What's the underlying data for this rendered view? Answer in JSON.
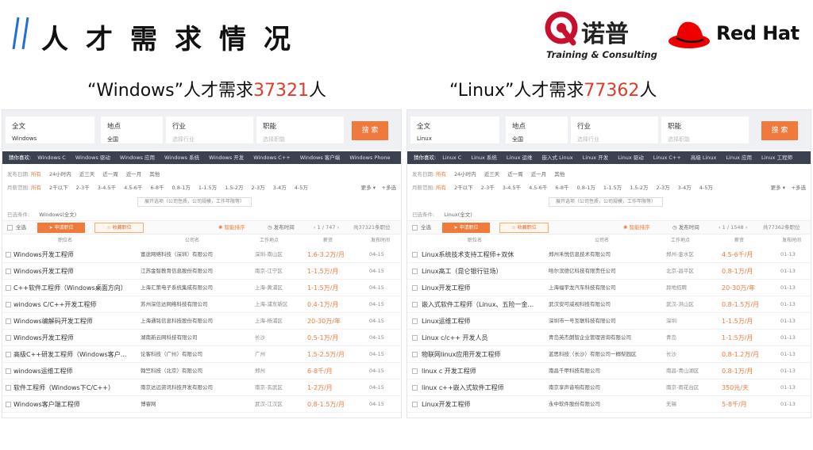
{
  "header": {
    "title": "人才需求情况",
    "nuopu_cn": "诺普",
    "nuopu_en": "Training & Consulting",
    "redhat": "Red Hat"
  },
  "colors": {
    "accent": "#f07a3c",
    "highlight": "#e03b2a",
    "redhat": "#ee0000",
    "nuopu": "#c8102e",
    "slash": "#1e6fd9"
  },
  "left": {
    "caption_pre": "“Windows”人才需求",
    "caption_num": "37321",
    "caption_post": "人",
    "search": {
      "full_label": "全文",
      "full_value": "Windows",
      "loc_label": "地点",
      "loc_value": "全国",
      "ind_label": "行业",
      "ind_ph": "选择行业",
      "pos_label": "职能",
      "pos_ph": "选择职能",
      "button": "搜 索"
    },
    "rec_label": "猜你喜欢:",
    "rec": [
      "Windows C",
      "Windows 驱动",
      "Windows 应用",
      "Windows 系统",
      "Windows 开发",
      "Windows C++",
      "Windows 客户端",
      "Windows Phone"
    ],
    "date_label": "发布日期:",
    "dates": [
      "所有",
      "24小时内",
      "近三天",
      "近一周",
      "近一月",
      "其他"
    ],
    "salary_label": "月薪范围:",
    "salaries": [
      "所有",
      "2千以下",
      "2-3千",
      "3-4.5千",
      "4.5-6千",
      "6-8千",
      "0.8-1万",
      "1-1.5万",
      "1.5-2万",
      "2-3万",
      "3-4万",
      "4-5万"
    ],
    "more": "更多",
    "multi": "+多选",
    "expand": "展开选项（公司性质，公司规模，工作年限等）",
    "cond_label": "已选条件:",
    "cond_value": "Windows(全文)",
    "select_all": "全选",
    "apply": "申请职位",
    "fav": "收藏职位",
    "smart": "智能排序",
    "pubtime": "发布时间",
    "pager": "1 / 747",
    "total": "共37321条职位",
    "cols": [
      "职位名",
      "公司名",
      "工作地点",
      "薪资",
      "发布时间"
    ],
    "rows": [
      {
        "title": "Windows开发工程师",
        "company": "富途网络科技（深圳）有限公司",
        "location": "深圳-南山区",
        "salary": "1.6-3.2万/月",
        "date": "04-15"
      },
      {
        "title": "Windows开发工程师",
        "company": "江苏金智教育信息股份有限公司",
        "location": "南京-江宁区",
        "salary": "1-1.5万/月",
        "date": "04-15"
      },
      {
        "title": "C++软件工程师（Windows桌面方向）",
        "company": "上海汇策电子系统集成有限公司",
        "location": "上海-黄浦区",
        "salary": "1-1.5万/月",
        "date": "04-15"
      },
      {
        "title": "windows C/C++开发工程师",
        "company": "苏州深信达网络科技有限公司",
        "location": "上海-浦东新区",
        "salary": "0.4-1万/月",
        "date": "04-15"
      },
      {
        "title": "Windows编解码开发工程师",
        "company": "上海通铭信息科技股份有限公司",
        "location": "上海-杨浦区",
        "salary": "20-30万/年",
        "date": "04-15"
      },
      {
        "title": "Windows开发工程师",
        "company": "湖南新云网科技有限公司",
        "location": "长沙",
        "salary": "0.5-1万/月",
        "date": "04-15"
      },
      {
        "title": "高级C++研发工程师（Windows客户...",
        "company": "论客科技（广州）有限公司",
        "location": "广州",
        "salary": "1.5-2.5万/月",
        "date": "04-15"
      },
      {
        "title": "windows运维工程师",
        "company": "翰竺科技（北京）有限公司",
        "location": "郑州",
        "salary": "6-8千/月",
        "date": "04-15"
      },
      {
        "title": "软件工程师（Windows下C/C++）",
        "company": "南京达远资讯科技开发有限公司",
        "location": "南京-玄武区",
        "salary": "1-2万/月",
        "date": "04-15"
      },
      {
        "title": "Windows客户端工程师",
        "company": "博睿网",
        "location": "武汉-江汉区",
        "salary": "0.8-1.5万/月",
        "date": "04-15"
      }
    ]
  },
  "right": {
    "caption_pre": "“Linux”人才需求",
    "caption_num": "77362",
    "caption_post": "人",
    "search": {
      "full_label": "全文",
      "full_value": "Linux",
      "loc_label": "地点",
      "loc_value": "全国",
      "ind_label": "行业",
      "ind_ph": "选择行业",
      "pos_label": "职能",
      "pos_ph": "选择职能",
      "button": "搜 索"
    },
    "rec_label": "猜你喜欢:",
    "rec": [
      "Linux C",
      "Linux 系统",
      "Linux 运维",
      "嵌入式 Linux",
      "Linux 开发",
      "Linux 驱动",
      "Linux C++",
      "高级 Linux",
      "Linux 应用",
      "Linux 工程师"
    ],
    "date_label": "发布日期:",
    "dates": [
      "所有",
      "24小时内",
      "近三天",
      "近一周",
      "近一月",
      "其他"
    ],
    "salary_label": "月薪范围:",
    "salaries": [
      "所有",
      "2千以下",
      "2-3千",
      "3-4.5千",
      "4.5-6千",
      "6-8千",
      "0.8-1万",
      "1-1.5万",
      "1.5-2万",
      "2-3万",
      "3-4万",
      "4-5万"
    ],
    "more": "更多",
    "multi": "+多选",
    "expand": "展开选项（公司性质，公司规模，工作年限等）",
    "cond_label": "已选条件:",
    "cond_value": "Linux(全文)",
    "select_all": "全选",
    "apply": "申请职位",
    "fav": "收藏职位",
    "smart": "智能排序",
    "pubtime": "发布时间",
    "pager": "1 / 1548",
    "total": "共77362条职位",
    "cols": [
      "职位名",
      "公司名",
      "工作地点",
      "薪资",
      "发布时间"
    ],
    "rows": [
      {
        "title": "Linux系统技术支持工程师+双休",
        "company": "郑州禾悦信息技术有限公司",
        "location": "郑州-金水区",
        "salary": "4.5-6千/月",
        "date": "01-13"
      },
      {
        "title": "Linux高工（昆仑银行驻场）",
        "company": "哈尔滨德亿科技有限责任公司",
        "location": "北京-昌平区",
        "salary": "0.8-1万/月",
        "date": "01-13"
      },
      {
        "title": "Linux开发工程师",
        "company": "上海福宇龙汽车科技有限公司",
        "location": "异地招聘",
        "salary": "20-30万/年",
        "date": "01-13"
      },
      {
        "title": "嵌入式软件工程师（Linux、五险一金...",
        "company": "武汉安可威视科技有限公司",
        "location": "武汉-洪山区",
        "salary": "0.8-1.5万/月",
        "date": "01-13"
      },
      {
        "title": "Linux运维工程师",
        "company": "深圳市一号互联科技有限公司",
        "location": "深圳",
        "salary": "1-1.5万/月",
        "date": "01-13"
      },
      {
        "title": "Linux c/c++ 开发人员",
        "company": "青岛英杰朗智企业管理咨询有限公司",
        "location": "青岛",
        "salary": "1-1.5万/月",
        "date": "01-13"
      },
      {
        "title": "物联网linux应用开发工程师",
        "company": "蓝思科技（长沙）有限公司一榔梨园区",
        "location": "长沙",
        "salary": "0.8-1.2万/月",
        "date": "01-13"
      },
      {
        "title": "linux c 开发工程师",
        "company": "南昌千甲科技有限公司",
        "location": "南昌-青山湖区",
        "salary": "0.8-1万/月",
        "date": "01-13"
      },
      {
        "title": "linux c++嵌入式软件工程师",
        "company": "南京享声音响有限公司",
        "location": "南京-雨花台区",
        "salary": "350元/天",
        "date": "01-13"
      },
      {
        "title": "Linux开发工程师",
        "company": "永中软件股份有限公司",
        "location": "无锡",
        "salary": "5-8千/月",
        "date": "01-13"
      }
    ]
  }
}
